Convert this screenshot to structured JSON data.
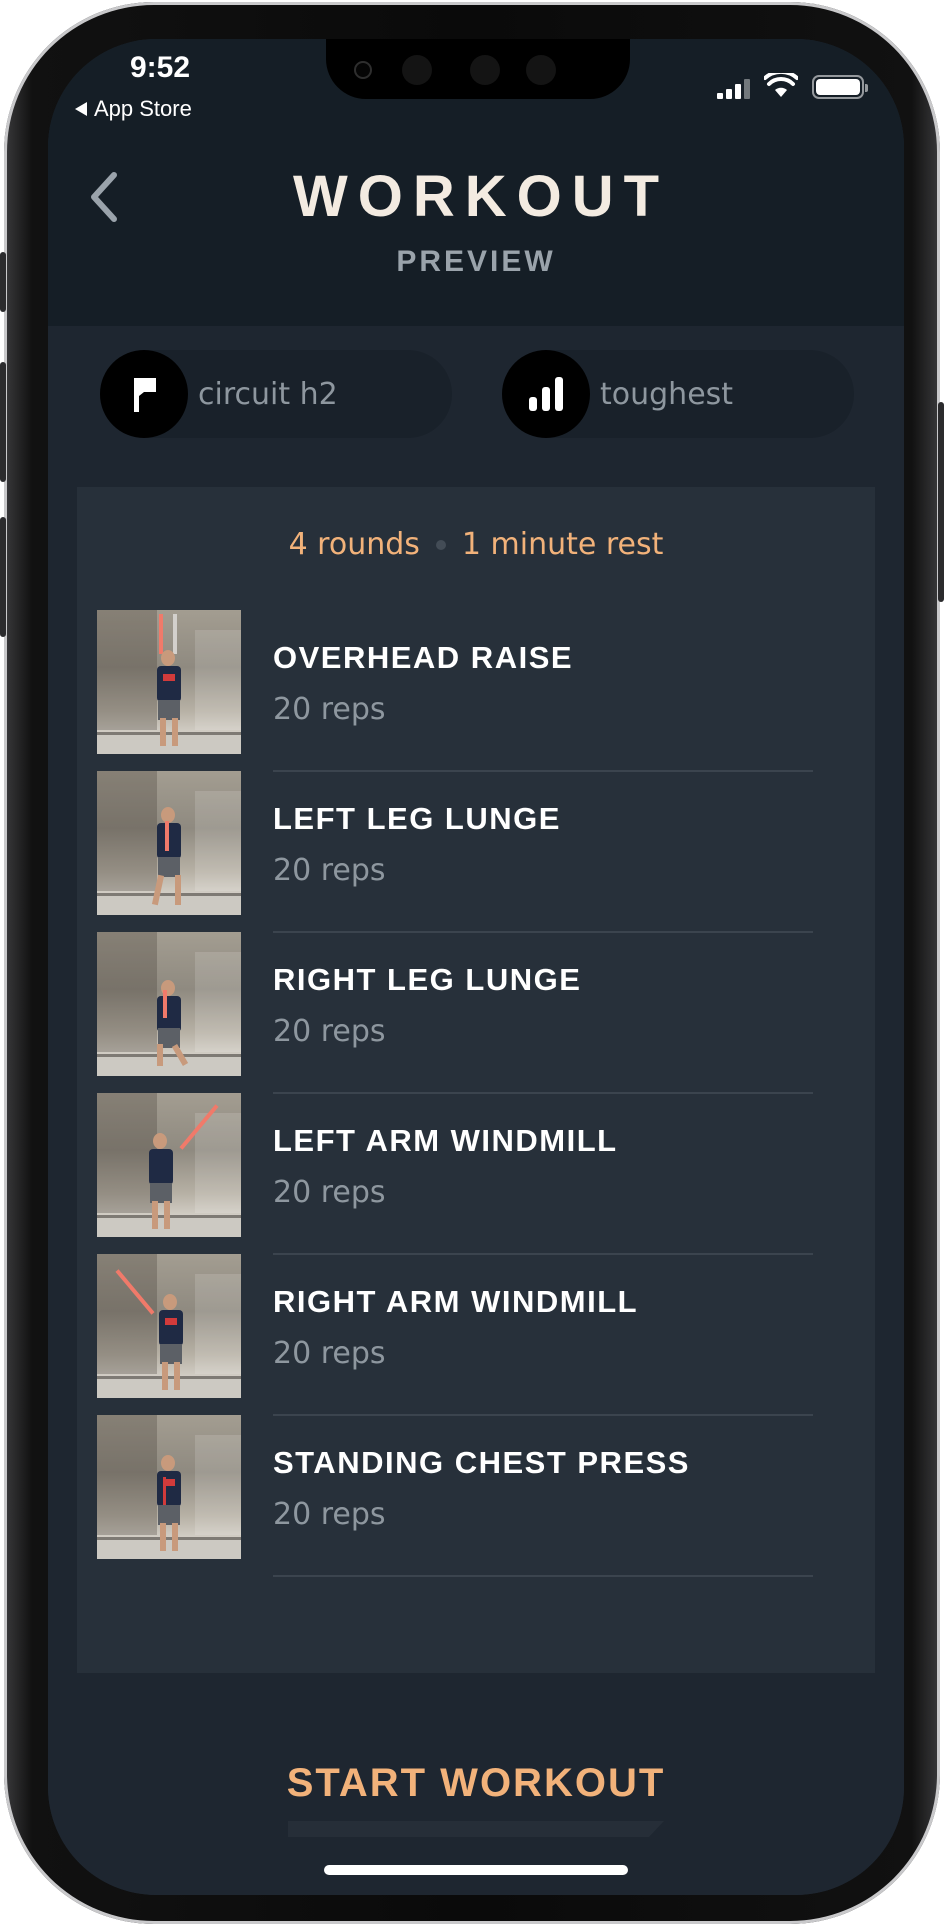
{
  "status_bar": {
    "time": "9:52",
    "back_app": "App Store"
  },
  "header": {
    "title": "WORKOUT",
    "subtitle": "PREVIEW"
  },
  "pills": [
    {
      "icon": "flag-icon",
      "label": "circuit h2"
    },
    {
      "icon": "difficulty-bars-icon",
      "label": "toughest"
    }
  ],
  "workout": {
    "rounds": "4 rounds",
    "rest": "1 minute rest",
    "exercises": [
      {
        "name": "OVERHEAD RAISE",
        "reps": "20 reps"
      },
      {
        "name": "LEFT LEG LUNGE",
        "reps": "20 reps"
      },
      {
        "name": "RIGHT LEG LUNGE",
        "reps": "20 reps"
      },
      {
        "name": "LEFT ARM WINDMILL",
        "reps": "20 reps"
      },
      {
        "name": "RIGHT ARM WINDMILL",
        "reps": "20 reps"
      },
      {
        "name": "STANDING CHEST PRESS",
        "reps": "20 reps"
      }
    ]
  },
  "footer": {
    "start_label": "START WORKOUT"
  },
  "colors": {
    "accent": "#f2b27a",
    "header_bg": "#151e26",
    "card_bg": "#27303a",
    "title_text": "#f3ebe1"
  }
}
